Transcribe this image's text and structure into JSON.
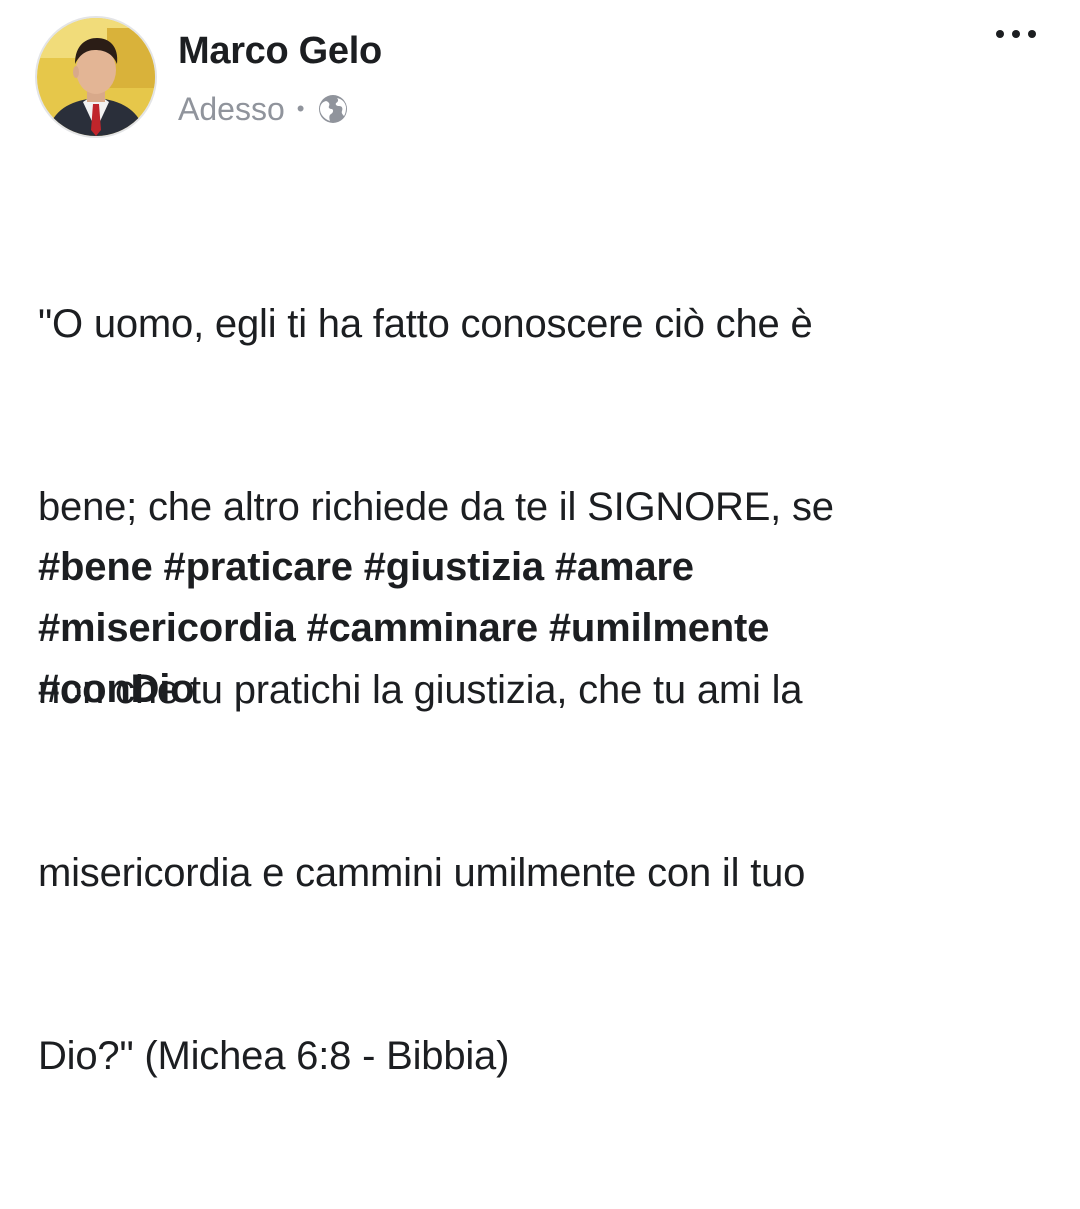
{
  "post": {
    "author": "Marco Gelo",
    "timestamp": "Adesso",
    "separator": "•",
    "privacy_icon": "globe-icon",
    "menu_icon": "more-options-icon",
    "text_lines": [
      "\"O uomo, egli ti ha fatto conoscere ciò che è",
      "bene; che altro richiede da te il SIGNORE, se",
      "non che tu pratichi la giustizia, che tu ami la",
      "misericordia e cammini umilmente con il tuo",
      "Dio?\" (Michea 6:8 - Bibbia)"
    ],
    "hashtags": [
      "#bene",
      "#praticare",
      "#giustizia",
      "#amare",
      "#misericordia",
      "#camminare",
      "#umilmente",
      "#conDio"
    ]
  },
  "colors": {
    "text": "#1c1e21",
    "meta": "#90949c",
    "background": "#ffffff"
  }
}
